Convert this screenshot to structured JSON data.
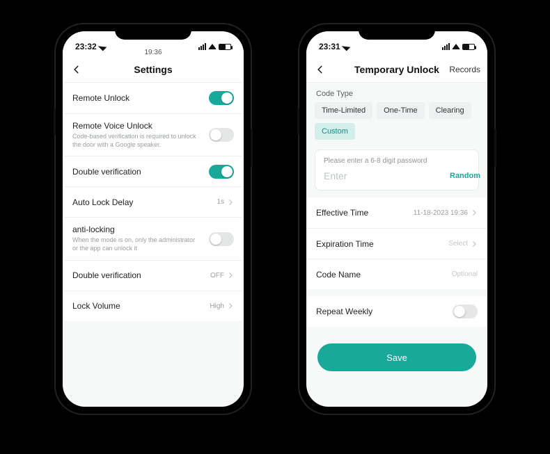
{
  "left": {
    "status": {
      "time_left": "23:32",
      "time_center": "19:36"
    },
    "nav": {
      "title": "Settings"
    },
    "rows": {
      "remote_unlock": {
        "label": "Remote Unlock"
      },
      "remote_voice": {
        "label": "Remote Voice Unlock",
        "sub": "Code-based verification is required to unlock the door with a Google speaker."
      },
      "double_verif": {
        "label": "Double verification"
      },
      "auto_lock": {
        "label": "Auto Lock Delay",
        "value": "1s"
      },
      "anti_locking": {
        "label": "anti-locking",
        "sub": "When the mode is on, only the administrator or the app can unlock it"
      },
      "double_verif2": {
        "label": "Double verification",
        "value": "OFF"
      },
      "lock_volume": {
        "label": "Lock Volume",
        "value": "High"
      }
    }
  },
  "right": {
    "status": {
      "time_left": "23:31"
    },
    "nav": {
      "title": "Temporary Unlock",
      "records": "Records"
    },
    "code_type_label": "Code Type",
    "chips": {
      "time_limited": "Time-Limited",
      "one_time": "One-Time",
      "clearing": "Clearing",
      "custom": "Custom"
    },
    "pwd": {
      "hint": "Please enter a 6-8 digit password",
      "placeholder": "Enter",
      "random": "Random"
    },
    "rows": {
      "effective": {
        "label": "Effective Time",
        "value": "11-18-2023 19:36"
      },
      "expiration": {
        "label": "Expiration Time",
        "value": "Select"
      },
      "code_name": {
        "label": "Code Name",
        "value": "Optional"
      },
      "repeat": {
        "label": "Repeat Weekly"
      }
    },
    "save": "Save"
  }
}
